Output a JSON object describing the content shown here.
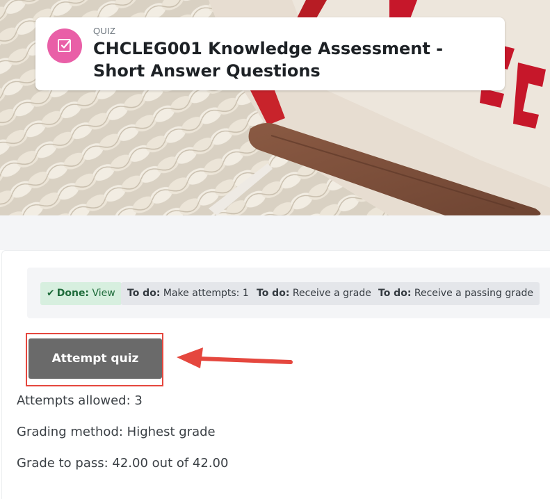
{
  "header": {
    "kind_label": "QUIZ",
    "title": "CHCLEG001 Knowledge Assessment - Short Answer Questions",
    "icon": "quiz-check-icon",
    "icon_color": "#e95fa7"
  },
  "completion": {
    "items": [
      {
        "status": "Done:",
        "text": "View",
        "state": "done"
      },
      {
        "status": "To do:",
        "text": "Make attempts: 1",
        "state": "todo"
      },
      {
        "status": "To do:",
        "text": "Receive a grade",
        "state": "todo"
      },
      {
        "status": "To do:",
        "text": "Receive a passing grade",
        "state": "todo"
      }
    ]
  },
  "actions": {
    "attempt_label": "Attempt quiz",
    "highlight_color": "#e5473e"
  },
  "info": {
    "attempts_allowed": "Attempts allowed: 3",
    "grading_method": "Grading method: Highest grade",
    "grade_to_pass": "Grade to pass: 42.00 out of 42.00"
  }
}
